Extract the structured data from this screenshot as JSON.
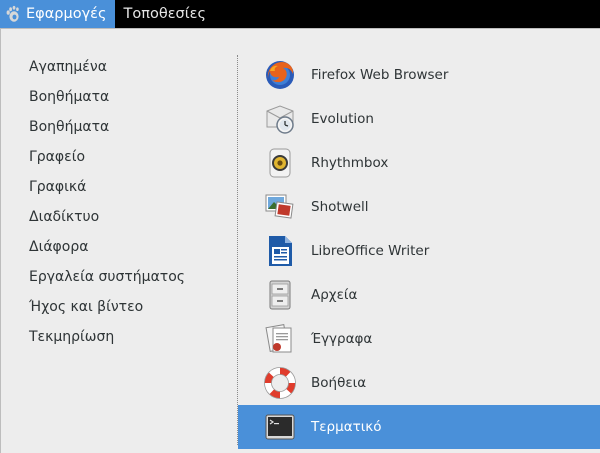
{
  "topbar": {
    "menus": [
      {
        "label": "Εφαρμογές",
        "icon": "gnome-foot-icon",
        "active": true
      },
      {
        "label": "Τοποθεσίες",
        "active": false
      }
    ]
  },
  "categories": [
    "Αγαπημένα",
    "Βοηθήματα",
    "Βοηθήματα",
    "Γραφείο",
    "Γραφικά",
    "Διαδίκτυο",
    "Διάφορα",
    "Εργαλεία συστήματος",
    "Ήχος και βίντεο",
    "Τεκμηρίωση"
  ],
  "apps": [
    {
      "label": "Firefox Web Browser",
      "icon": "firefox-icon"
    },
    {
      "label": "Evolution",
      "icon": "evolution-icon"
    },
    {
      "label": "Rhythmbox",
      "icon": "rhythmbox-icon"
    },
    {
      "label": "Shotwell",
      "icon": "shotwell-icon"
    },
    {
      "label": "LibreOffice Writer",
      "icon": "libreoffice-writer-icon"
    },
    {
      "label": "Αρχεία",
      "icon": "files-icon"
    },
    {
      "label": "Έγγραφα",
      "icon": "documents-icon"
    },
    {
      "label": "Βοήθεια",
      "icon": "help-lifebuoy-icon"
    },
    {
      "label": "Τερματικό",
      "icon": "terminal-icon",
      "selected": true
    }
  ],
  "colors": {
    "selection": "#4a90d9",
    "panel_bg": "#ededed",
    "topbar_bg": "#000000",
    "text": "#2e3436"
  }
}
